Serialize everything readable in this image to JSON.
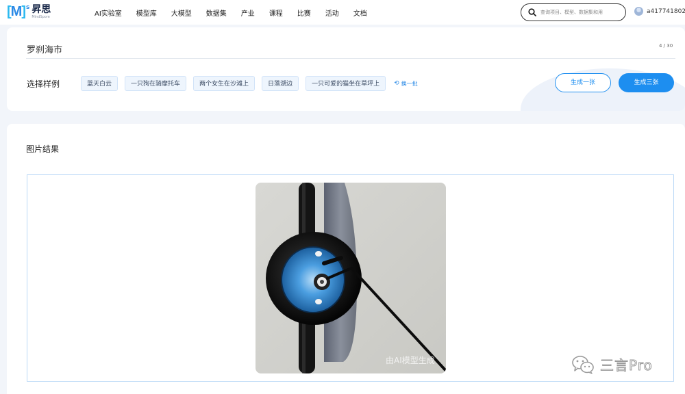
{
  "brand": {
    "mark": "M",
    "sup": "s",
    "name": "昇思",
    "sub": "MindSpore"
  },
  "nav": {
    "items": [
      "AI实验室",
      "模型库",
      "大模型",
      "数据集",
      "产业",
      "课程",
      "比赛",
      "活动",
      "文档"
    ]
  },
  "search": {
    "placeholder": "查询项目、模型、数据集和用"
  },
  "user": {
    "name": "a417741802"
  },
  "prompt": {
    "text": "罗刹海市",
    "count": "4 / 30"
  },
  "samples": {
    "label": "选择样例",
    "chips": [
      "蓝天白云",
      "一只狗在骑摩托车",
      "两个女生在沙滩上",
      "日落湖边",
      "一只可爱的猫坐在草坪上"
    ],
    "refresh_label": "换一批",
    "refresh_icon": "refresh-icon"
  },
  "actions": {
    "generate_one": "生成一张",
    "generate_three": "生成三张"
  },
  "result": {
    "title": "图片结果",
    "watermark": "由AI模型生成"
  },
  "overlay": {
    "wechat_name": "三言Pro",
    "icon": "wechat-icon"
  },
  "colors": {
    "accent": "#1d8ef0",
    "chip_bg": "#eef5fd",
    "chip_border": "#d2e3f8",
    "page_bg": "#f2f5fa"
  }
}
